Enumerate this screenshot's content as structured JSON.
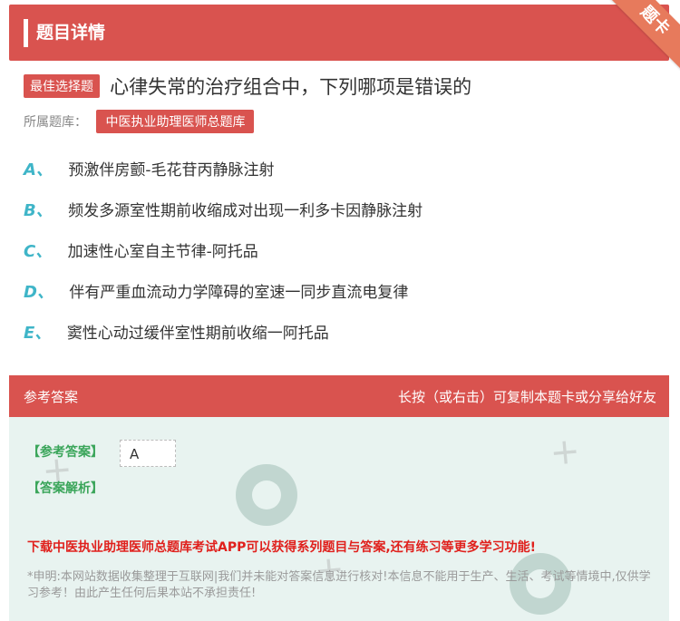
{
  "header": {
    "title": "题目详情",
    "ribbon": "题卡"
  },
  "question": {
    "tag": "最佳选择题",
    "text": "心律失常的治疗组合中，下列哪项是错误的",
    "bank_label": "所属题库：",
    "bank_name": "中医执业助理医师总题库"
  },
  "options": [
    {
      "letter": "A、",
      "text": "预激伴房颤-毛花苷丙静脉注射"
    },
    {
      "letter": "B、",
      "text": "频发多源室性期前收缩成对出现一利多卡因静脉注射"
    },
    {
      "letter": "C、",
      "text": "加速性心室自主节律-阿托品"
    },
    {
      "letter": "D、",
      "text": "伴有严重血流动力学障碍的室速一同步直流电复律"
    },
    {
      "letter": "E、",
      "text": "窦性心动过缓伴室性期前收缩一阿托品"
    }
  ],
  "answer_section": {
    "title": "参考答案",
    "hint": "长按（或右击）可复制本题卡或分享给好友",
    "answer_label": "【参考答案】",
    "answer_value": "A",
    "analysis_label": "【答案解析】",
    "download_text": "下载中医执业助理医师总题库考试APP可以获得系列题目与答案,还有练习等更多学习功能!",
    "disclaimer": "*申明:本网站数据收集整理于互联网|我们并未能对答案信息进行核对!本信息不能用于生产、生活、考试等情境中,仅供学习参考！由此产生任何后果本站不承担责任!"
  },
  "colors": {
    "primary": "#d9534f",
    "option_letter": "#3fb5c8",
    "answer_label": "#3aa55a",
    "download": "#e0201c"
  }
}
